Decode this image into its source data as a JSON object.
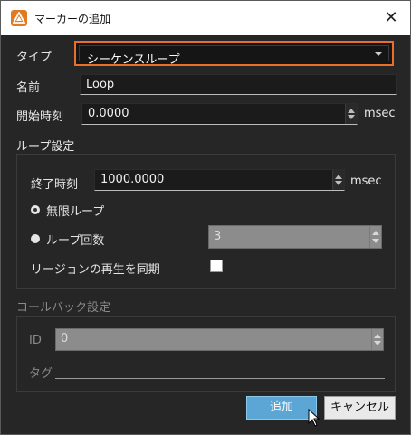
{
  "window": {
    "title": "マーカーの追加",
    "close_label": "✕"
  },
  "type_row": {
    "label": "タイプ",
    "value": "シーケンスループ"
  },
  "name_row": {
    "label": "名前",
    "value": "Loop"
  },
  "start_row": {
    "label": "開始時刻",
    "value": "0.0000",
    "unit": "msec"
  },
  "loop_group": {
    "title": "ループ設定",
    "end_label": "終了時刻",
    "end_value": "1000.0000",
    "end_unit": "msec",
    "infinite_label": "無限ループ",
    "count_label": "ループ回数",
    "count_value": "3",
    "sync_label": "リージョンの再生を同期"
  },
  "callback_group": {
    "title": "コールバック設定",
    "id_label": "ID",
    "id_value": "0",
    "tag_label": "タグ",
    "tag_value": ""
  },
  "buttons": {
    "add": "追加",
    "cancel": "キャンセル"
  }
}
